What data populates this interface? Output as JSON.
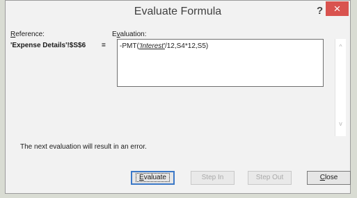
{
  "dialog": {
    "title": "Evaluate Formula",
    "help_label": "?",
    "close_label": "×"
  },
  "reference": {
    "label_prefix": "R",
    "label_rest": "eference:",
    "value": "'Expense Details'!$S$6"
  },
  "evaluation": {
    "label_prefix": "E",
    "label_underline": "v",
    "label_rest": "aluation:",
    "equals": "=",
    "formula_before": "-PMT(",
    "formula_highlight": "'Interest'",
    "formula_after": "/12,S4*12,S5)"
  },
  "message": "The next evaluation will result in an error.",
  "buttons": {
    "evaluate": {
      "prefix": "E",
      "rest": "valuate"
    },
    "step_in": "Step In",
    "step_out": "Step Out",
    "close": {
      "prefix": "C",
      "rest": "lose"
    }
  },
  "scrollbar": {
    "up_glyph": "^",
    "down_glyph": "v"
  }
}
